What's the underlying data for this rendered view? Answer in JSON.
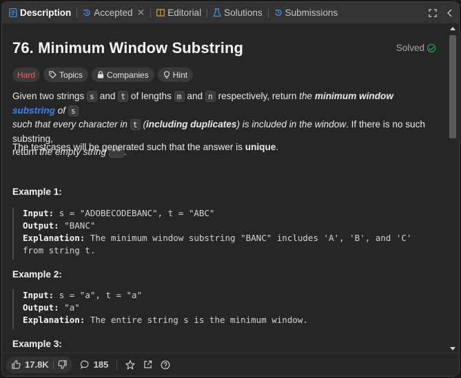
{
  "tabs": [
    {
      "label": "Description",
      "icon": "description-icon",
      "active": true
    },
    {
      "label": "Accepted",
      "icon": "history-icon",
      "closable": true
    },
    {
      "label": "Editorial",
      "icon": "book-icon"
    },
    {
      "label": "Solutions",
      "icon": "flask-icon"
    },
    {
      "label": "Submissions",
      "icon": "history-icon"
    }
  ],
  "problem": {
    "title": "76. Minimum Window Substring",
    "status": "Solved",
    "difficulty": "Hard",
    "tags": [
      "Topics",
      "Companies",
      "Hint"
    ]
  },
  "description": {
    "p1_a": "Given two strings ",
    "s": "s",
    "and": " and ",
    "t": "t",
    "p1_b": " of lengths ",
    "m": "m",
    "n": "n",
    "p1_c": " respectively, return ",
    "the": "the ",
    "min_window": "minimum window",
    "substring": "substring",
    "of": " of ",
    "p1_d": "such that every character in ",
    "incl": "including duplicates",
    "p1_e": " is included in the window",
    "p1_f": ". If there is no such substring,",
    "p1_g": "return ",
    "empty": "the empty string",
    "quote": "\"\"",
    "p2_a": "The testcases will be generated such that the answer is ",
    "unique": "unique"
  },
  "examples": [
    {
      "title": "Example 1:",
      "input_label": "Input:",
      "input": "s = \"ADOBECODEBANC\", t = \"ABC\"",
      "output_label": "Output:",
      "output": "\"BANC\"",
      "explanation_label": "Explanation:",
      "explanation": "The minimum window substring \"BANC\" includes 'A', 'B', and 'C'",
      "explanation_2": "from string t."
    },
    {
      "title": "Example 2:",
      "input_label": "Input:",
      "input": "s = \"a\", t = \"a\"",
      "output_label": "Output:",
      "output": "\"a\"",
      "explanation_label": "Explanation:",
      "explanation": "The entire string s is the minimum window."
    },
    {
      "title": "Example 3:"
    }
  ],
  "bottom": {
    "likes": "17.8K",
    "comments": "185"
  }
}
